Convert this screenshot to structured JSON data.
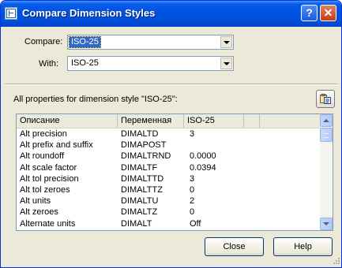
{
  "window": {
    "title": "Compare Dimension Styles",
    "help_glyph": "?",
    "close_glyph": "✕"
  },
  "compare": {
    "label": "Compare:",
    "value": "ISO-25"
  },
  "with": {
    "label": "With:",
    "value": "ISO-25"
  },
  "properties": {
    "caption": "All properties for dimension style \"ISO-25\":",
    "columns": [
      "Описание",
      "Переменная",
      "ISO-25"
    ],
    "rows": [
      [
        "Alt precision",
        "DIMALTD",
        "3"
      ],
      [
        "Alt prefix and suffix",
        "DIMAPOST",
        ""
      ],
      [
        "Alt roundoff",
        "DIMALTRND",
        "0.0000"
      ],
      [
        "Alt scale factor",
        "DIMALTF",
        "0.0394"
      ],
      [
        "Alt tol precision",
        "DIMALTTD",
        "3"
      ],
      [
        "Alt tol zeroes",
        "DIMALTTZ",
        "0"
      ],
      [
        "Alt units",
        "DIMALTU",
        "2"
      ],
      [
        "Alt zeroes",
        "DIMALTZ",
        "0"
      ],
      [
        "Alternate units",
        "DIMALT",
        "Off"
      ]
    ]
  },
  "buttons": {
    "close": "Close",
    "help": "Help"
  },
  "colors": {
    "titlebar": "#0054e3",
    "dialog_bg": "#ece9d8",
    "selection": "#316ac5"
  }
}
